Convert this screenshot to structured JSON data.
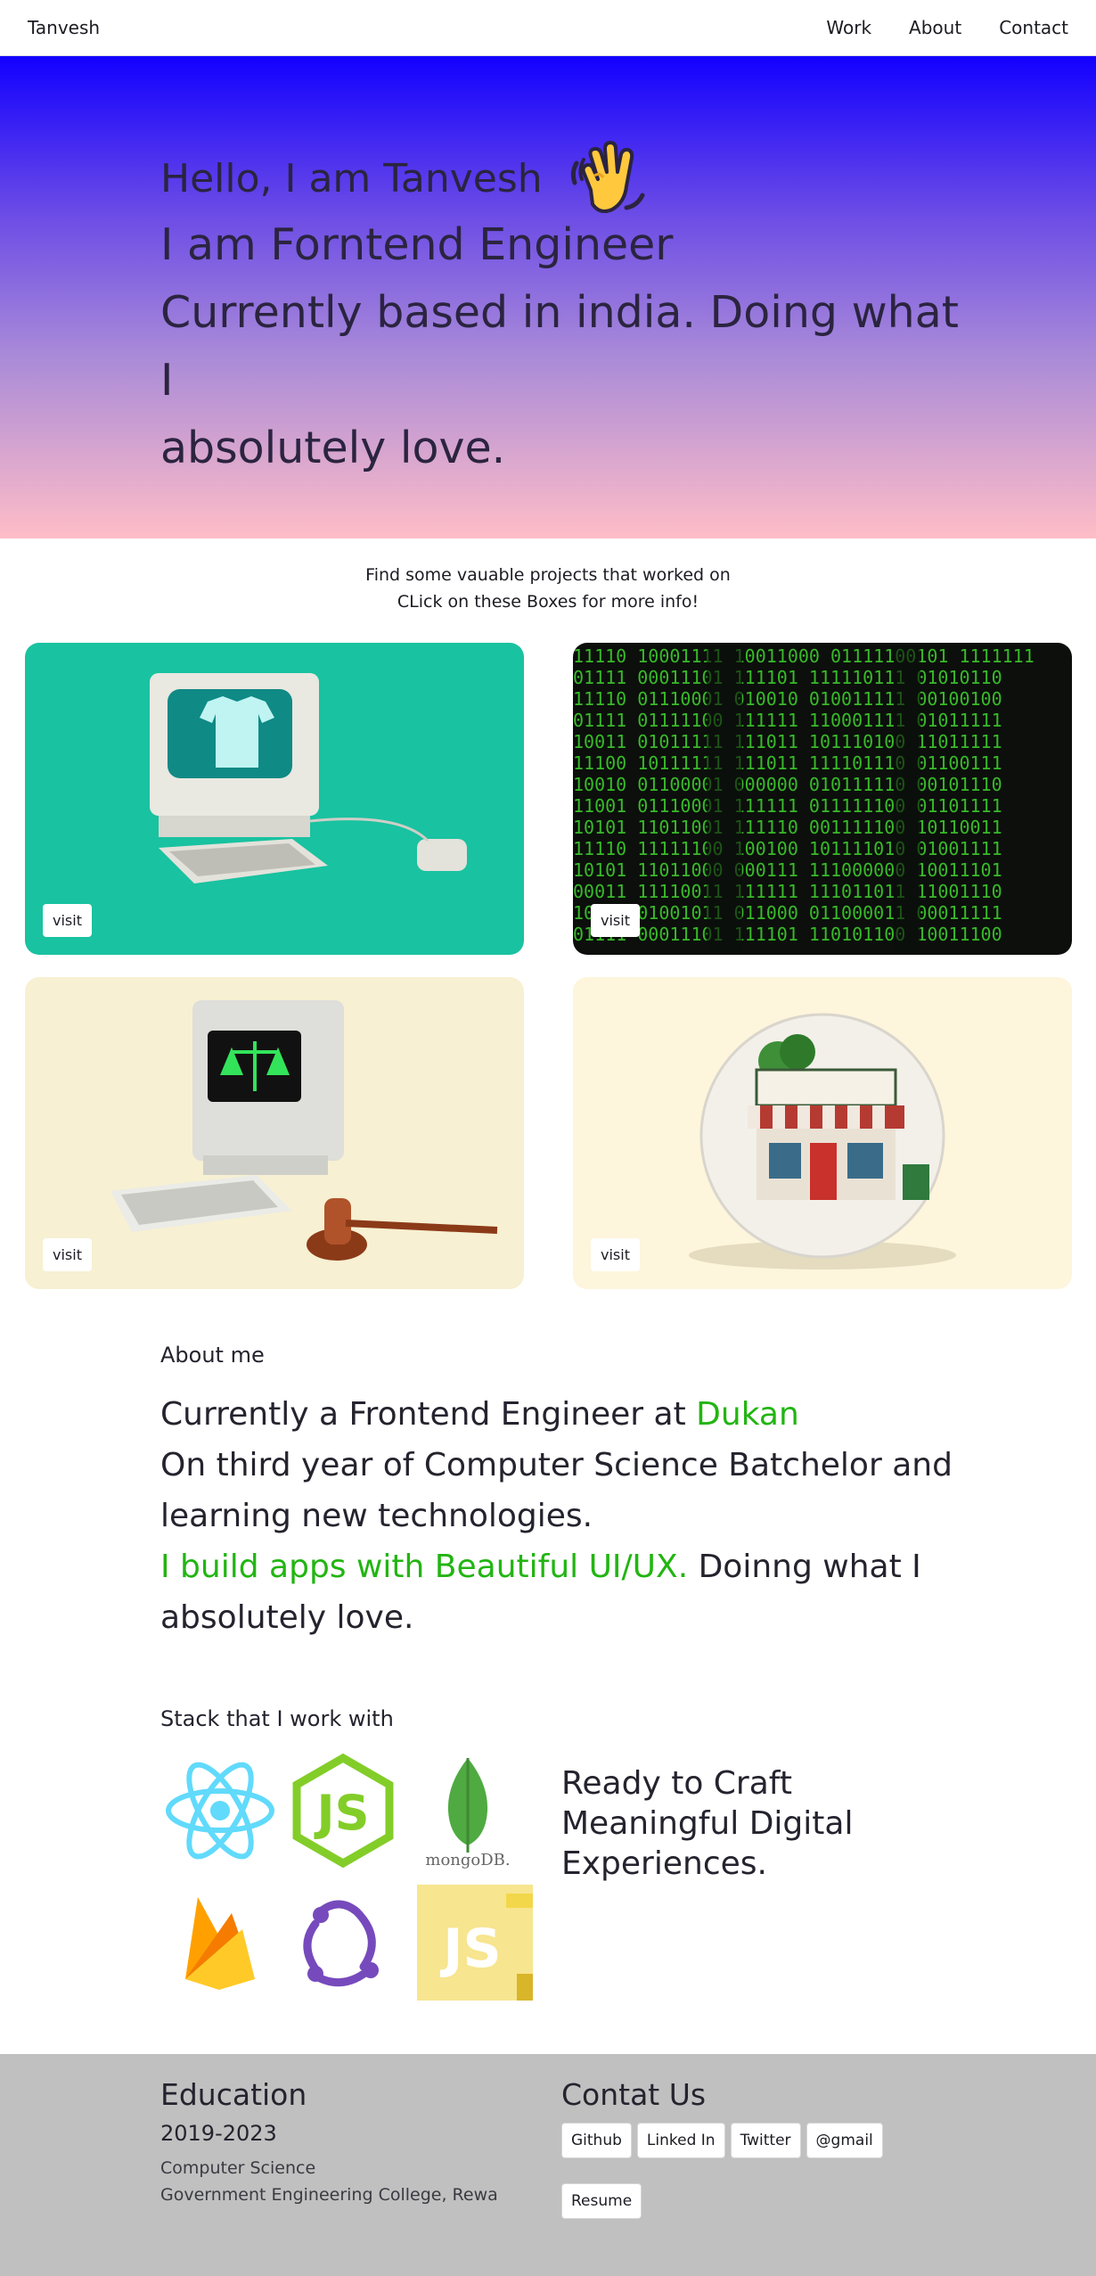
{
  "nav": {
    "brand": "Tanvesh",
    "links": [
      "Work",
      "About",
      "Contact"
    ]
  },
  "hero": {
    "hello": "Hello, I am Tanvesh",
    "line1": "I am Forntend Engineer",
    "line2": "Currently based in india. Doing what I",
    "line3": "absolutely love."
  },
  "projects": {
    "intro1": "Find some vauable projects that worked on",
    "intro2": "CLick on these Boxes for more info!",
    "visit_label": "visit"
  },
  "about": {
    "title": "About me",
    "line1_prefix": "Currently a Frontend Engineer at ",
    "company": "Dukan",
    "line2": "On third year of Computer Science Batchelor and learning new technologies.",
    "highlight": "I build apps with Beautiful UI/UX.",
    "line3_suffix": " Doinng what I absolutely love."
  },
  "stack": {
    "title": "Stack that I work with",
    "icons": [
      "react-icon",
      "nodejs-icon",
      "mongodb-icon",
      "firebase-icon",
      "redux-icon",
      "javascript-icon"
    ],
    "mongo_label": "mongoDB.",
    "js_label": "JS",
    "node_label": "JS",
    "ready_text": "Ready to Craft Meaningful Digital Experiences."
  },
  "footer": {
    "edu_title": "Education",
    "years": "2019-2023",
    "degree": "Computer Science",
    "college": "Government Engineering College, Rewa",
    "contact_title": "Contat Us",
    "buttons": [
      "Github",
      "Linked In",
      "Twitter",
      "@gmail"
    ],
    "resume": "Resume"
  },
  "colors": {
    "accent_green": "#22b512",
    "hero_top": "#1200ff",
    "hero_bottom": "#ffbdc7",
    "footer_bg": "#c0c0c0"
  }
}
